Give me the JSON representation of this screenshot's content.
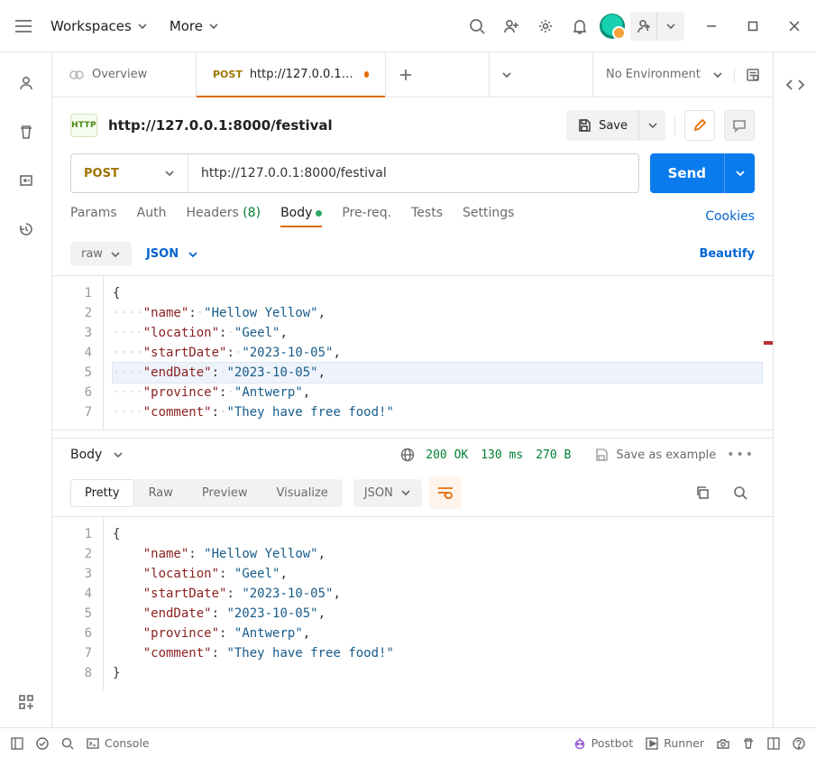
{
  "menubar": {
    "workspaces": "Workspaces",
    "more": "More"
  },
  "env": {
    "label": "No Environment"
  },
  "tabs": {
    "overview": "Overview",
    "request": {
      "method": "POST",
      "title": "http://127.0.0.1:8000/fe"
    }
  },
  "titlebar": {
    "badge": "HTTP",
    "url": "http://127.0.0.1:8000/festival",
    "save": "Save"
  },
  "urlbar": {
    "method": "POST",
    "url": "http://127.0.0.1:8000/festival",
    "send": "Send"
  },
  "req_tabs": {
    "params": "Params",
    "auth": "Auth",
    "headers": "Headers",
    "headers_count": "(8)",
    "body": "Body",
    "prereq": "Pre-req.",
    "tests": "Tests",
    "settings": "Settings",
    "cookies": "Cookies"
  },
  "body_opts": {
    "raw": "raw",
    "json": "JSON",
    "beautify": "Beautify"
  },
  "request_json": {
    "name": "Hellow Yellow",
    "location": "Geel",
    "startDate": "2023-10-05",
    "endDate": "2023-10-05",
    "province": "Antwerp",
    "comment": "They have free food!"
  },
  "response_head": {
    "label": "Body",
    "status": "200 OK",
    "time": "130 ms",
    "size": "270 B",
    "save_example": "Save as example"
  },
  "resp_view": {
    "pretty": "Pretty",
    "raw": "Raw",
    "preview": "Preview",
    "visualize": "Visualize",
    "json": "JSON"
  },
  "response_json": {
    "name": "Hellow Yellow",
    "location": "Geel",
    "startDate": "2023-10-05",
    "endDate": "2023-10-05",
    "province": "Antwerp",
    "comment": "They have free food!"
  },
  "statusbar": {
    "console": "Console",
    "postbot": "Postbot",
    "runner": "Runner"
  }
}
